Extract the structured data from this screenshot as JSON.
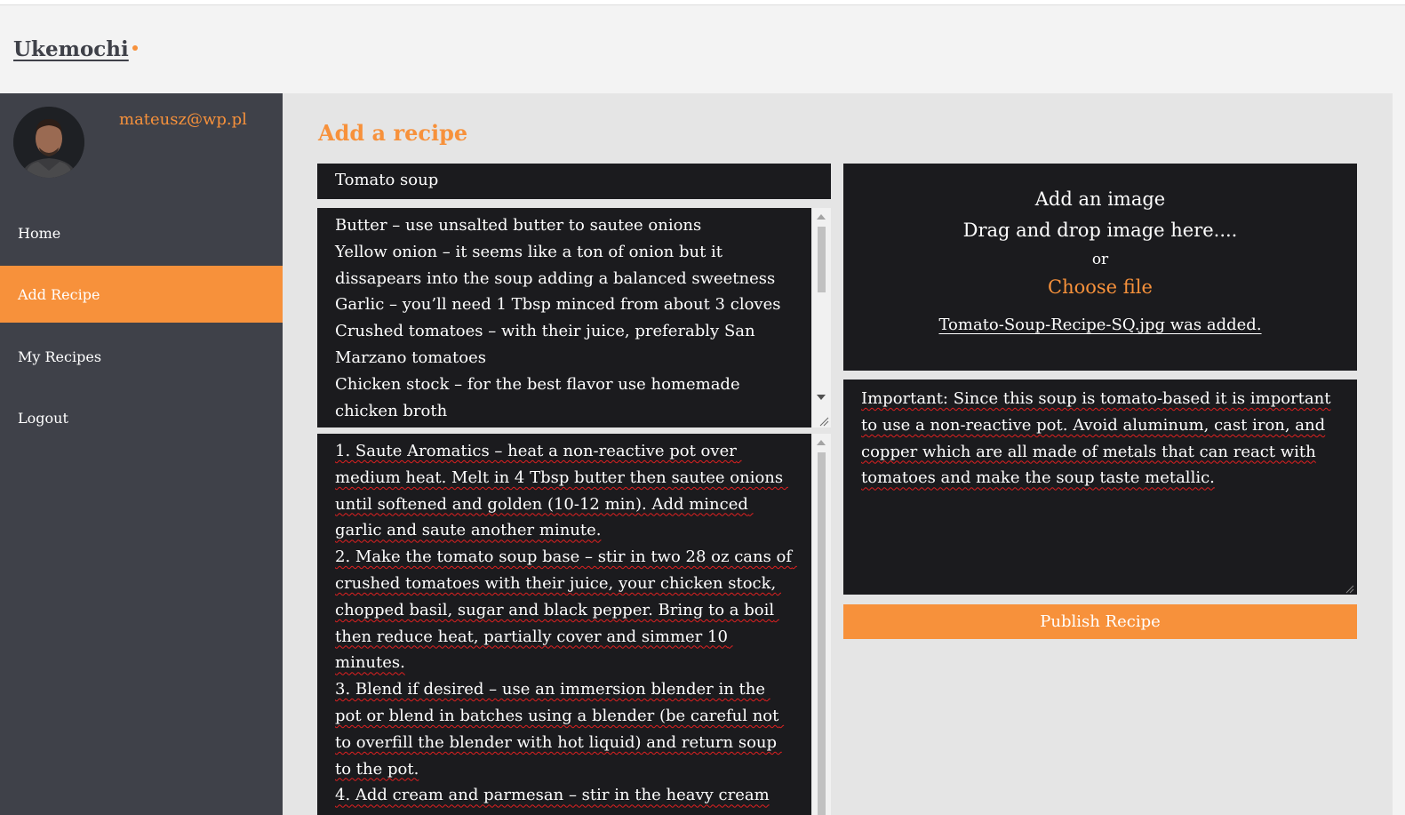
{
  "header": {
    "logo": "Ukemochi"
  },
  "user": {
    "email": "mateusz@wp.pl"
  },
  "sidebar": {
    "items": [
      {
        "label": "Home",
        "active": false
      },
      {
        "label": "Add Recipe",
        "active": true
      },
      {
        "label": "My Recipes",
        "active": false
      },
      {
        "label": "Logout",
        "active": false
      }
    ]
  },
  "main": {
    "title": "Add a recipe",
    "recipe_title_value": "Tomato soup",
    "ingredients_lines": [
      "Butter – use unsalted butter to sautee onions",
      "Yellow onion – it seems like a ton of onion but it dissapears into the soup adding a balanced sweetness",
      "Garlic – you’ll need 1 Tbsp minced from about 3 cloves",
      "Crushed tomatoes – with their juice, preferably San Marzano tomatoes",
      "Chicken stock – for the best flavor use homemade chicken broth"
    ],
    "method_lines": [
      "1. Saute Aromatics – heat a non-reactive pot over medium heat. Melt in 4 Tbsp butter then sautee onions until softened and golden (10-12 min). Add minced garlic and saute another minute.",
      "2. Make the tomato soup base – stir in two 28 oz cans of crushed tomatoes with their juice, your chicken stock, chopped basil, sugar and black pepper. Bring to a boil then reduce heat, partially cover and simmer 10 minutes.",
      "3. Blend if desired – use an immersion blender in the pot or blend in batches using a blender (be careful not to overfill the blender with hot liquid) and return soup to the pot.",
      "4. Add cream and parmesan – stir in the heavy cream"
    ],
    "image_upload": {
      "title": "Add an image",
      "subtitle": "Drag and drop image here....",
      "or": "or",
      "choose": "Choose file",
      "added": "Tomato-Soup-Recipe-SQ.jpg was added."
    },
    "notes_value": "Important: Since this soup is tomato-based it is important to use a non-reactive pot. Avoid aluminum, cast iron, and copper which are all made of metals that can react with tomatoes and make the soup taste metallic.",
    "publish_label": "Publish Recipe"
  },
  "colors": {
    "accent": "#f7913b",
    "sidebar": "#3f4149",
    "field": "#1b1b1e",
    "content_bg": "#e5e5e5"
  }
}
